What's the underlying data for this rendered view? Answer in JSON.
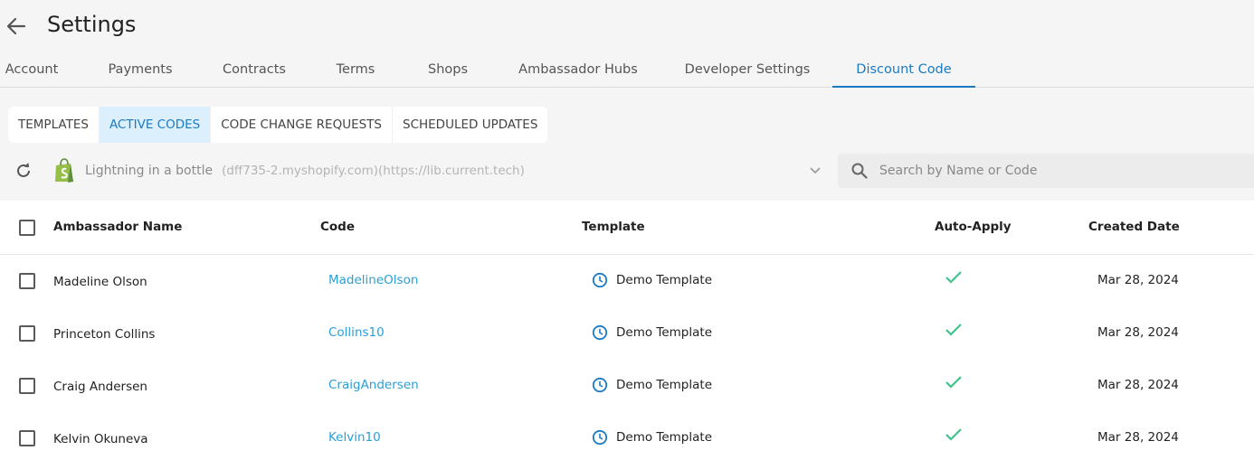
{
  "header": {
    "title": "Settings",
    "back_icon": "arrow-left-icon"
  },
  "tabs": [
    {
      "label": "Account",
      "active": false
    },
    {
      "label": "Payments",
      "active": false
    },
    {
      "label": "Contracts",
      "active": false
    },
    {
      "label": "Terms",
      "active": false
    },
    {
      "label": "Shops",
      "active": false
    },
    {
      "label": "Ambassador Hubs",
      "active": false
    },
    {
      "label": "Developer Settings",
      "active": false
    },
    {
      "label": "Discount Code",
      "active": true
    }
  ],
  "subtabs": [
    {
      "label": "TEMPLATES",
      "active": false
    },
    {
      "label": "ACTIVE CODES",
      "active": true
    },
    {
      "label": "CODE CHANGE REQUESTS",
      "active": false
    },
    {
      "label": "SCHEDULED UPDATES",
      "active": false
    }
  ],
  "shop": {
    "name": "Lightning in a bottle",
    "detail": "(dff735-2.myshopify.com)(https://lib.current.tech)"
  },
  "search": {
    "placeholder": "Search by Name or Code",
    "value": ""
  },
  "table": {
    "columns": [
      "Ambassador Name",
      "Code",
      "Template",
      "Auto-Apply",
      "Created Date"
    ],
    "rows": [
      {
        "name": "Madeline Olson",
        "code": "MadelineOlson",
        "template": "Demo Template",
        "auto_apply": true,
        "created": "Mar 28, 2024"
      },
      {
        "name": "Princeton Collins",
        "code": "Collins10",
        "template": "Demo Template",
        "auto_apply": true,
        "created": "Mar 28, 2024"
      },
      {
        "name": "Craig Andersen",
        "code": "CraigAndersen",
        "template": "Demo Template",
        "auto_apply": true,
        "created": "Mar 28, 2024"
      },
      {
        "name": "Kelvin Okuneva",
        "code": "Kelvin10",
        "template": "Demo Template",
        "auto_apply": true,
        "created": "Mar 28, 2024"
      }
    ]
  },
  "colors": {
    "accent": "#1a7bc4",
    "link": "#2a9fd6",
    "check": "#3cc48a",
    "active_subtab_bg": "#dceffd"
  }
}
